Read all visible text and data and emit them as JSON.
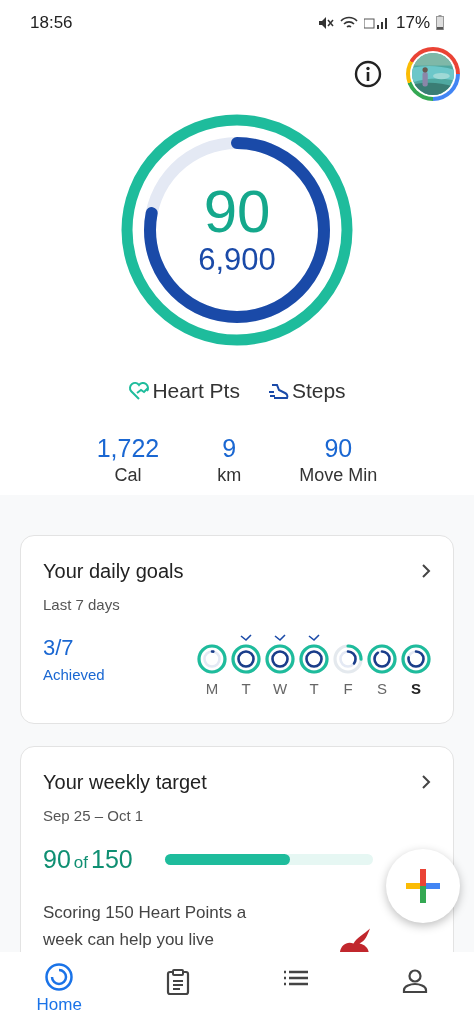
{
  "status_bar": {
    "time": "18:56",
    "battery": "17%"
  },
  "summary": {
    "heart_points": "90",
    "steps": "6,900",
    "rings": [
      {
        "kind": "heart",
        "level": 1
      },
      {
        "kind": "steps",
        "level": 0.78
      }
    ]
  },
  "legend": [
    "Heart Pts",
    "Steps"
  ],
  "stats": [
    {
      "value": "1,722",
      "label": "Cal"
    },
    {
      "value": "9",
      "label": "km"
    },
    {
      "value": "90",
      "label": "Move Min"
    }
  ],
  "daily_goals": {
    "title": "Your daily goals",
    "subtitle": "Last 7 days",
    "achieved_count": "3/7",
    "achieved_label": "Achieved",
    "days": [
      {
        "label": "M",
        "achieved": false,
        "today": false,
        "level": 1
      },
      {
        "label": "T",
        "achieved": true,
        "today": false,
        "level": 1
      },
      {
        "label": "W",
        "achieved": true,
        "today": false,
        "level": 1
      },
      {
        "label": "T",
        "achieved": true,
        "today": false,
        "level": 1
      },
      {
        "label": "F",
        "achieved": false,
        "today": false,
        "level": 0.25
      },
      {
        "label": "S",
        "achieved": false,
        "today": false,
        "level": 1
      },
      {
        "label": "S",
        "achieved": false,
        "today": true,
        "level": 1
      }
    ]
  },
  "weekly_target": {
    "title": "Your weekly target",
    "dates": "Sep 25 – Oct 1",
    "score": "90",
    "of": "of",
    "target": "150",
    "level": 0.6,
    "text": "Scoring 150 Heart Points a week can help you live"
  },
  "nav": [
    {
      "label": "Home",
      "selected": true
    },
    {
      "selected": false
    },
    {
      "selected": false
    },
    {
      "selected": false
    }
  ]
}
